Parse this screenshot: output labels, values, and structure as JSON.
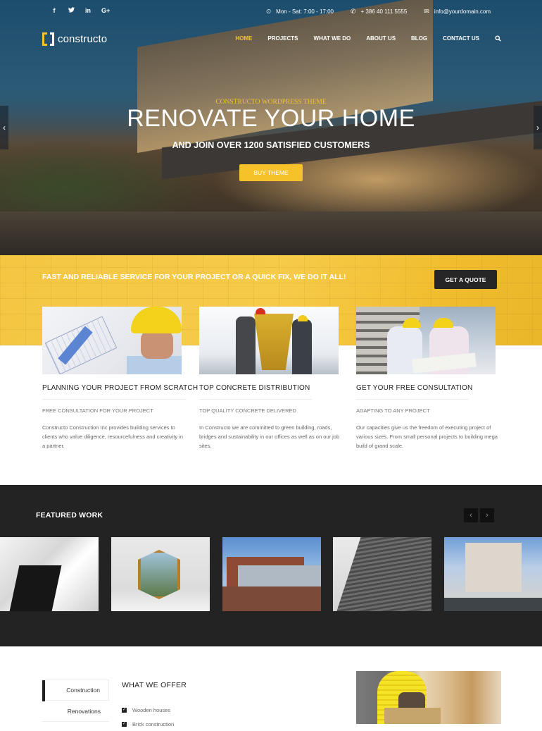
{
  "topbar": {
    "social": [
      {
        "icon": "facebook-icon",
        "glyph": "f"
      },
      {
        "icon": "twitter-icon",
        "glyph": "🐦"
      },
      {
        "icon": "linkedin-icon",
        "glyph": "in"
      },
      {
        "icon": "google-plus-icon",
        "glyph": "G+"
      }
    ],
    "hours_icon": "⏲",
    "hours": "Mon - Sat: 7:00 - 17:00",
    "phone_icon": "✆",
    "phone": "+ 386 40 111 5555",
    "email_icon": "✉",
    "email": "info@yourdomain.com"
  },
  "header": {
    "logo_text": "constructo",
    "nav": [
      {
        "label": "HOME",
        "active": true
      },
      {
        "label": "PROJECTS"
      },
      {
        "label": "WHAT WE DO"
      },
      {
        "label": "ABOUT US"
      },
      {
        "label": "BLOG"
      },
      {
        "label": "CONTACT US"
      }
    ],
    "search_icon": "⚲"
  },
  "hero": {
    "kicker": "CONSTRUCTO WORDPRESS THEME",
    "title": "RENOVATE YOUR HOME",
    "subtitle": "AND JOIN OVER 1200 SATISFIED CUSTOMERS",
    "button": "BUY THEME",
    "prev_arrow": "‹",
    "next_arrow": "›"
  },
  "cta": {
    "text": "FAST AND RELIABLE SERVICE FOR YOUR PROJECT OR A QUICK FIX, WE DO IT ALL!",
    "button": "GET A QUOTE"
  },
  "services": [
    {
      "title": "PLANNING YOUR PROJECT FROM SCRATCH",
      "subtitle": "FREE CONSULTATION FOR YOUR PROJECT",
      "description": "Constructo Construction Inc provides building services to clients who value diligence, resourcefulness and creativity in a partner."
    },
    {
      "title": "TOP CONCRETE DISTRIBUTION",
      "subtitle": "TOP QUALITY CONCRETE DELIVERED",
      "description": "In Constructo we are committed to green building, roads, bridges and sustainability in our offices as well as on our job sites."
    },
    {
      "title": "GET YOUR FREE CONSULTATION",
      "subtitle": "ADAPTING TO ANY PROJECT",
      "description": "Our capacities give us the freedom of executing project of various sizes. From small personal projects to building mega build of grand scale."
    }
  ],
  "featured": {
    "title": "FEATURED WORK",
    "prev": "‹",
    "next": "›"
  },
  "offer": {
    "tabs": [
      {
        "label": "Construction",
        "active": true
      },
      {
        "label": "Renovations"
      }
    ],
    "title": "WHAT WE OFFER",
    "items": [
      "Wooden houses",
      "Brick construction"
    ],
    "check": "✓"
  }
}
